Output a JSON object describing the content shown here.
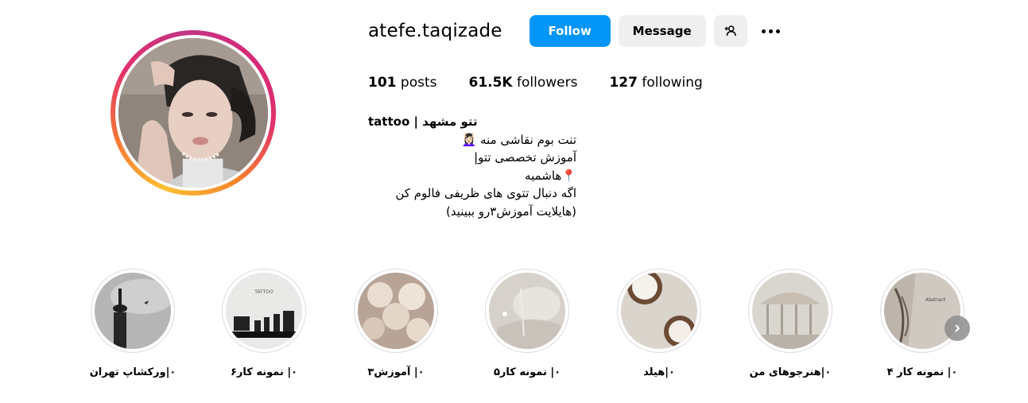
{
  "profile": {
    "username": "atefe.taqizade",
    "follow_label": "Follow",
    "message_label": "Message",
    "add_user_icon": "add-user-icon",
    "more_icon": "more-icon"
  },
  "stats": {
    "posts_count": "101",
    "posts_label": "posts",
    "followers_count": "61.5K",
    "followers_label": "followers",
    "following_count": "127",
    "following_label": "following"
  },
  "bio": {
    "name": "tattoo | تتو مشهد",
    "lines": [
      "تنت بوم نقاشی منه 💆🏻‍♀️",
      "آموزش تخصصی تتو|",
      "📍هاشمیه",
      "اگه دنبال تتوی های ظریفی فالوم کن",
      "(هایلایت آموزش۳رو ببینید)"
    ]
  },
  "highlights": [
    {
      "label": "۰|ورکشاپ تهران"
    },
    {
      "label": "۰| نمونه کار۶"
    },
    {
      "label": "۰| آموزش۳"
    },
    {
      "label": "۰| نمونه کار۵"
    },
    {
      "label": "۰|هیلد"
    },
    {
      "label": "۰|هنرجوهای من"
    },
    {
      "label": "۰| نمونه کار ۴"
    }
  ],
  "highlight_image_text": {
    "tattoo_title": "TATTOO",
    "abstract_title": "Abstract"
  },
  "colors": {
    "follow_button": "#0095f6",
    "secondary_button": "#efefef"
  }
}
